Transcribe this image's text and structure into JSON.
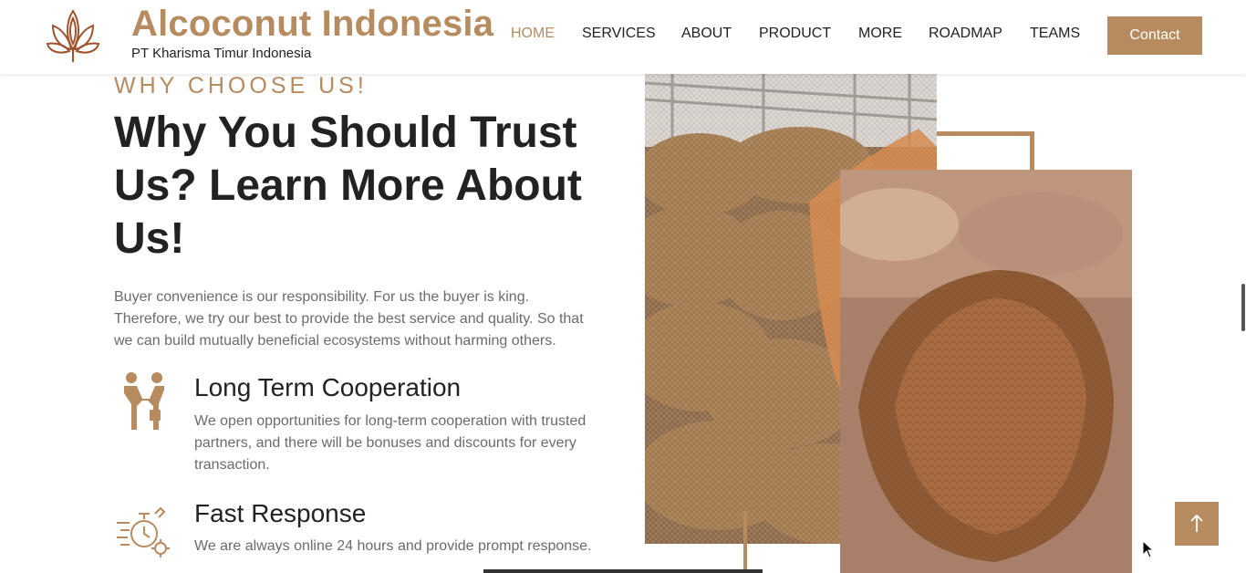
{
  "header": {
    "brand_title": "Alcoconut Indonesia",
    "brand_subtitle": "PT Kharisma Timur Indonesia",
    "logo_icon": "lotus-leaf-icon",
    "nav": [
      {
        "label": "HOME",
        "active": true
      },
      {
        "label": "SERVICES",
        "active": false
      },
      {
        "label": "ABOUT",
        "active": false
      },
      {
        "label": "PRODUCT",
        "active": false
      },
      {
        "label": "MORE",
        "active": false
      },
      {
        "label": "ROADMAP",
        "active": false
      },
      {
        "label": "TEAMS",
        "active": false
      }
    ],
    "contact_label": "Contact"
  },
  "section": {
    "eyebrow": "WHY CHOOSE US!",
    "heading": "Why You Should Trust Us? Learn More About Us!",
    "intro": "Buyer convenience is our responsibility. For us the buyer is king. Therefore, we try our best to provide the best service and quality. So that we can build mutually beneficial ecosystems without harming others.",
    "features": [
      {
        "icon": "handshake-icon",
        "title": "Long Term Cooperation",
        "description": "We open opportunities for long-term cooperation with trusted partners, and there will be bonuses and discounts for every transaction."
      },
      {
        "icon": "fast-clock-gear-icon",
        "title": "Fast Response",
        "description": "We are always online 24 hours and provide prompt response."
      }
    ]
  },
  "scroll_top_icon": "arrow-up-icon",
  "colors": {
    "accent": "#b58b5f",
    "text_dark": "#222222",
    "text_muted": "#6b6b6b"
  }
}
